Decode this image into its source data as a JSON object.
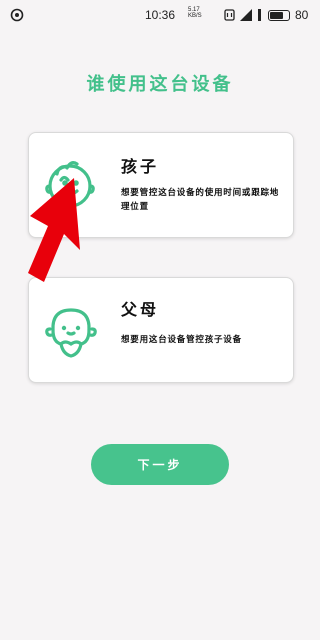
{
  "status_bar": {
    "time": "10:36",
    "speed_value": "5.17",
    "speed_unit": "KB/S",
    "battery": "80",
    "battery_level": 0.8,
    "icons": [
      "app-icon",
      "alarm-icon",
      "signal-icon",
      "wifi-icon",
      "battery-icon"
    ]
  },
  "page": {
    "title": "谁使用这台设备"
  },
  "options": [
    {
      "title": "孩子",
      "description": "想要管控这台设备的使用时间或跟踪地理位置",
      "icon": "child-face-icon"
    },
    {
      "title": "父母",
      "description": "想要用这台设备管控孩子设备",
      "icon": "parent-face-icon"
    }
  ],
  "next_button": {
    "label": "下一步"
  },
  "colors": {
    "accent": "#43c08b",
    "button": "#47c38d",
    "arrow": "#e8000b",
    "background": "#f6f4f5"
  }
}
